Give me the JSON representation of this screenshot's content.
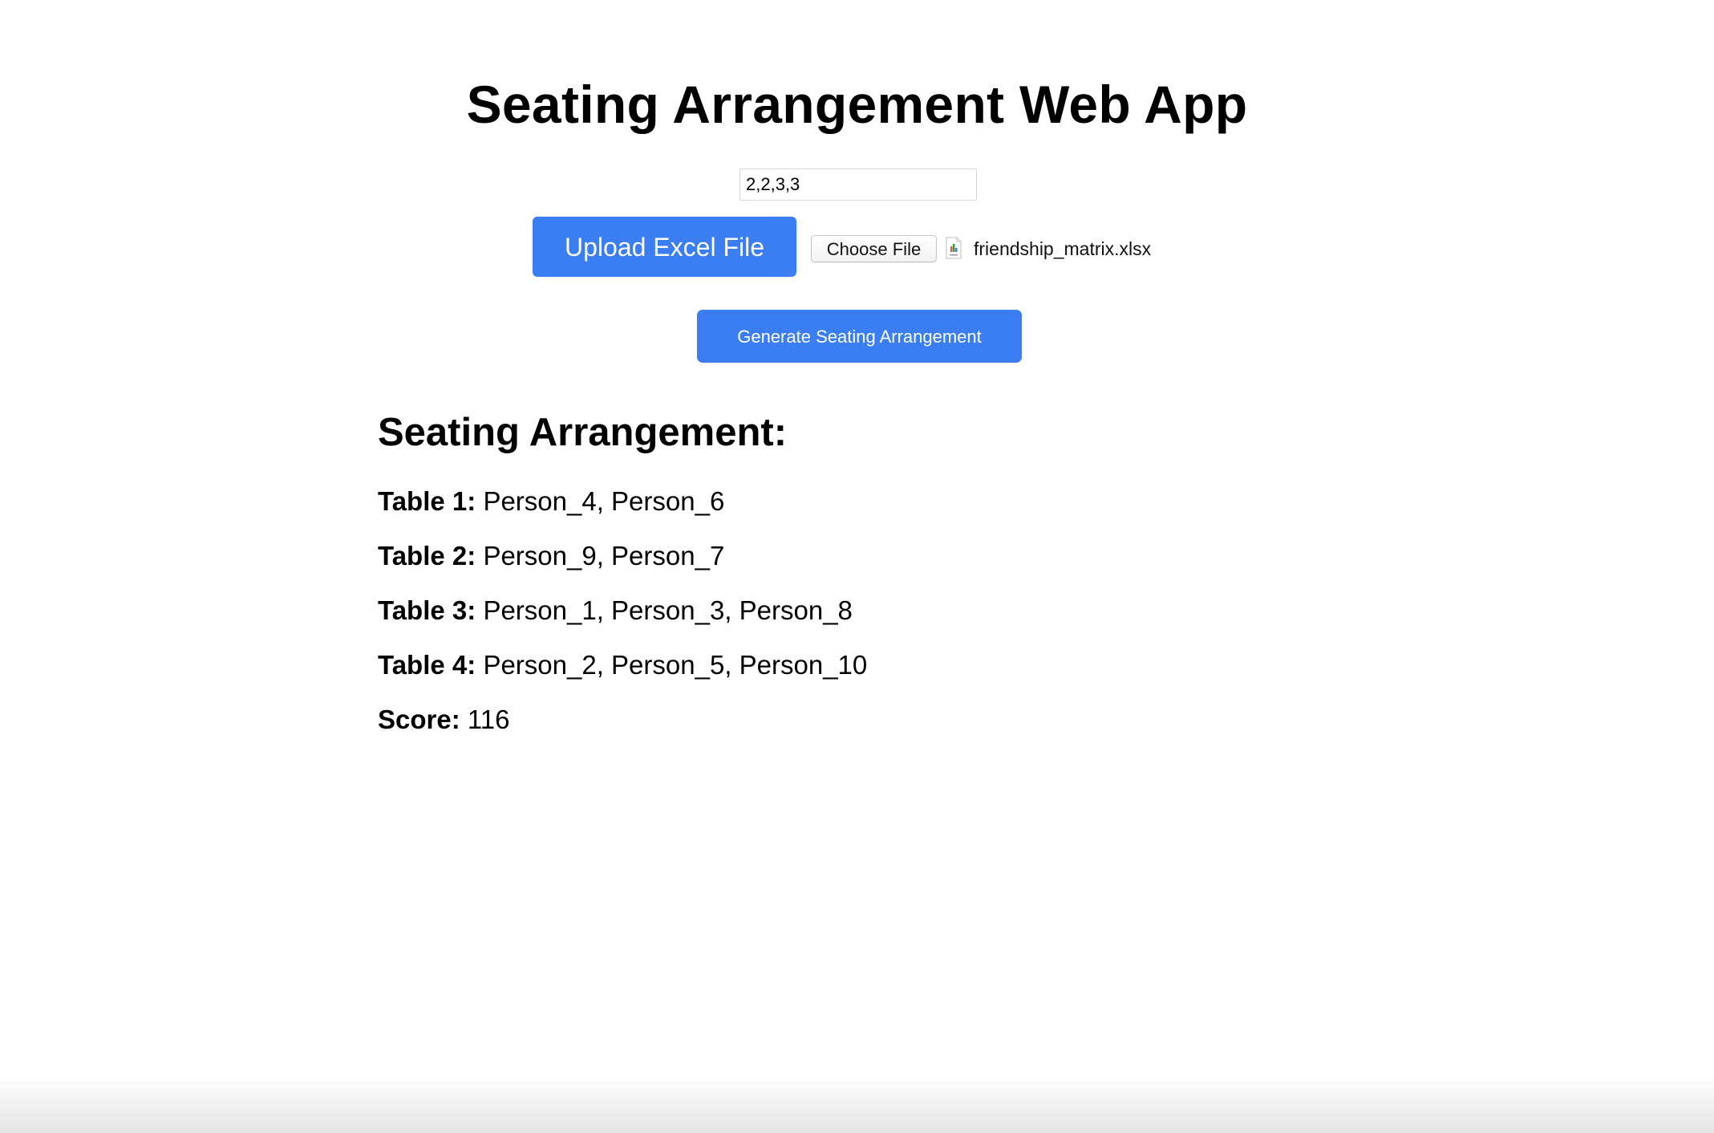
{
  "header": {
    "title": "Seating Arrangement Web App"
  },
  "controls": {
    "table_sizes_value": "2,2,3,3",
    "upload_label": "Upload Excel File",
    "choose_file_label": "Choose File",
    "file_name": "friendship_matrix.xlsx",
    "file_icon": "excel-file-icon",
    "generate_label": "Generate Seating Arrangement",
    "accent_color": "#3a7ef2"
  },
  "results": {
    "heading": "Seating Arrangement:",
    "tables": [
      {
        "label": "Table 1:",
        "people": "Person_4, Person_6"
      },
      {
        "label": "Table 2:",
        "people": "Person_9, Person_7"
      },
      {
        "label": "Table 3:",
        "people": "Person_1, Person_3, Person_8"
      },
      {
        "label": "Table 4:",
        "people": "Person_2, Person_5, Person_10"
      }
    ],
    "score_label": "Score:",
    "score_value": "116"
  }
}
